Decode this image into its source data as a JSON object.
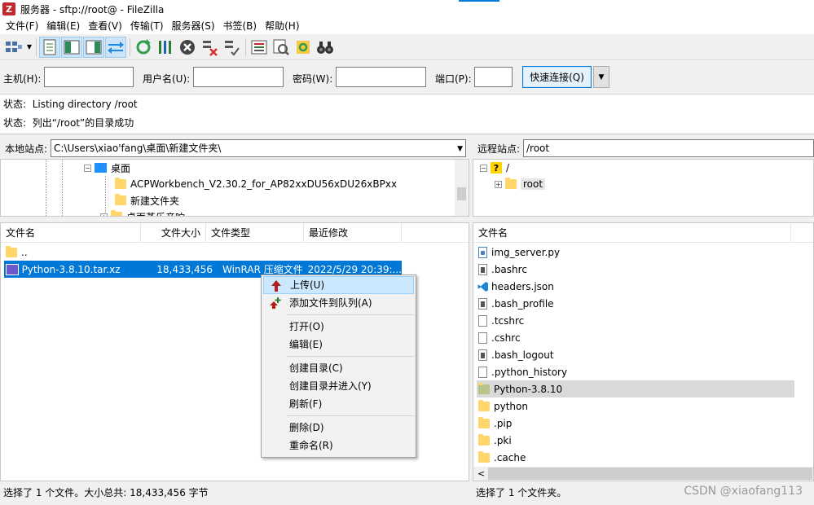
{
  "window": {
    "title": "服务器 - sftp://root@                    - FileZilla",
    "icon": "filezilla-icon"
  },
  "menu": [
    "文件(F)",
    "编辑(E)",
    "查看(V)",
    "传输(T)",
    "服务器(S)",
    "书签(B)",
    "帮助(H)"
  ],
  "quickconnect": {
    "host_label": "主机(H):",
    "user_label": "用户名(U):",
    "pass_label": "密码(W):",
    "port_label": "端口(P):",
    "host_value": "",
    "user_value": "",
    "pass_value": "",
    "port_value": "",
    "connect_label": "快速连接(Q)"
  },
  "log": [
    {
      "label": "状态:",
      "text": "Listing directory /root"
    },
    {
      "label": "状态:",
      "text": "列出“/root”的目录成功"
    }
  ],
  "local": {
    "site_label": "本地站点:",
    "path": "C:\\Users\\xiao'fang\\桌面\\新建文件夹\\",
    "tree": [
      {
        "name": "桌面",
        "type": "desktop"
      },
      {
        "name": "ACPWorkbench_V2.30.2_for_AP82xxDU56xDU26xBPxx",
        "type": "folder"
      },
      {
        "name": "新建文件夹",
        "type": "folder"
      },
      {
        "name": "桌面蒸乐音响",
        "type": "folder"
      }
    ],
    "columns": [
      "文件名",
      "文件大小",
      "文件类型",
      "最近修改"
    ],
    "files": [
      {
        "name": "..",
        "size": "",
        "type": "",
        "modified": ""
      },
      {
        "name": "Python-3.8.10.tar.xz",
        "size": "18,433,456",
        "type": "WinRAR 压缩文件",
        "modified": "2022/5/29 20:39:..."
      }
    ],
    "status": "选择了 1 个文件。大小总共: 18,433,456 字节"
  },
  "remote": {
    "site_label": "远程站点:",
    "path": "/root",
    "tree": [
      {
        "name": "/",
        "type": "unknown"
      },
      {
        "name": "root",
        "type": "folder"
      }
    ],
    "columns": [
      "文件名"
    ],
    "files": [
      {
        "name": "img_server.py",
        "icon": "python-file-icon"
      },
      {
        "name": ".bashrc",
        "icon": "config-file-icon"
      },
      {
        "name": "headers.json",
        "icon": "vscode-file-icon"
      },
      {
        "name": ".bash_profile",
        "icon": "config-file-icon"
      },
      {
        "name": ".tcshrc",
        "icon": "file-icon"
      },
      {
        "name": ".cshrc",
        "icon": "file-icon"
      },
      {
        "name": ".bash_logout",
        "icon": "config-file-icon"
      },
      {
        "name": ".python_history",
        "icon": "file-icon"
      },
      {
        "name": "Python-3.8.10",
        "icon": "folder-icon"
      },
      {
        "name": "python",
        "icon": "folder-icon"
      },
      {
        "name": ".pip",
        "icon": "folder-icon"
      },
      {
        "name": ".pki",
        "icon": "folder-icon"
      },
      {
        "name": ".cache",
        "icon": "folder-icon"
      }
    ],
    "status": "选择了 1 个文件夹。"
  },
  "context_menu": [
    {
      "label": "上传(U)",
      "icon": "upload-arrow-icon",
      "highlighted": true
    },
    {
      "label": "添加文件到队列(A)",
      "icon": "add-to-queue-icon"
    },
    {
      "label": "打开(O)"
    },
    {
      "label": "编辑(E)"
    },
    {
      "label": "创建目录(C)"
    },
    {
      "label": "创建目录并进入(Y)"
    },
    {
      "label": "刷新(F)"
    },
    {
      "label": "删除(D)"
    },
    {
      "label": "重命名(R)"
    }
  ],
  "watermark": "CSDN @xiaofang113",
  "colors": {
    "selection": "#0078d7",
    "menu_highlight": "#cce8ff",
    "folder": "#ffd66b"
  }
}
